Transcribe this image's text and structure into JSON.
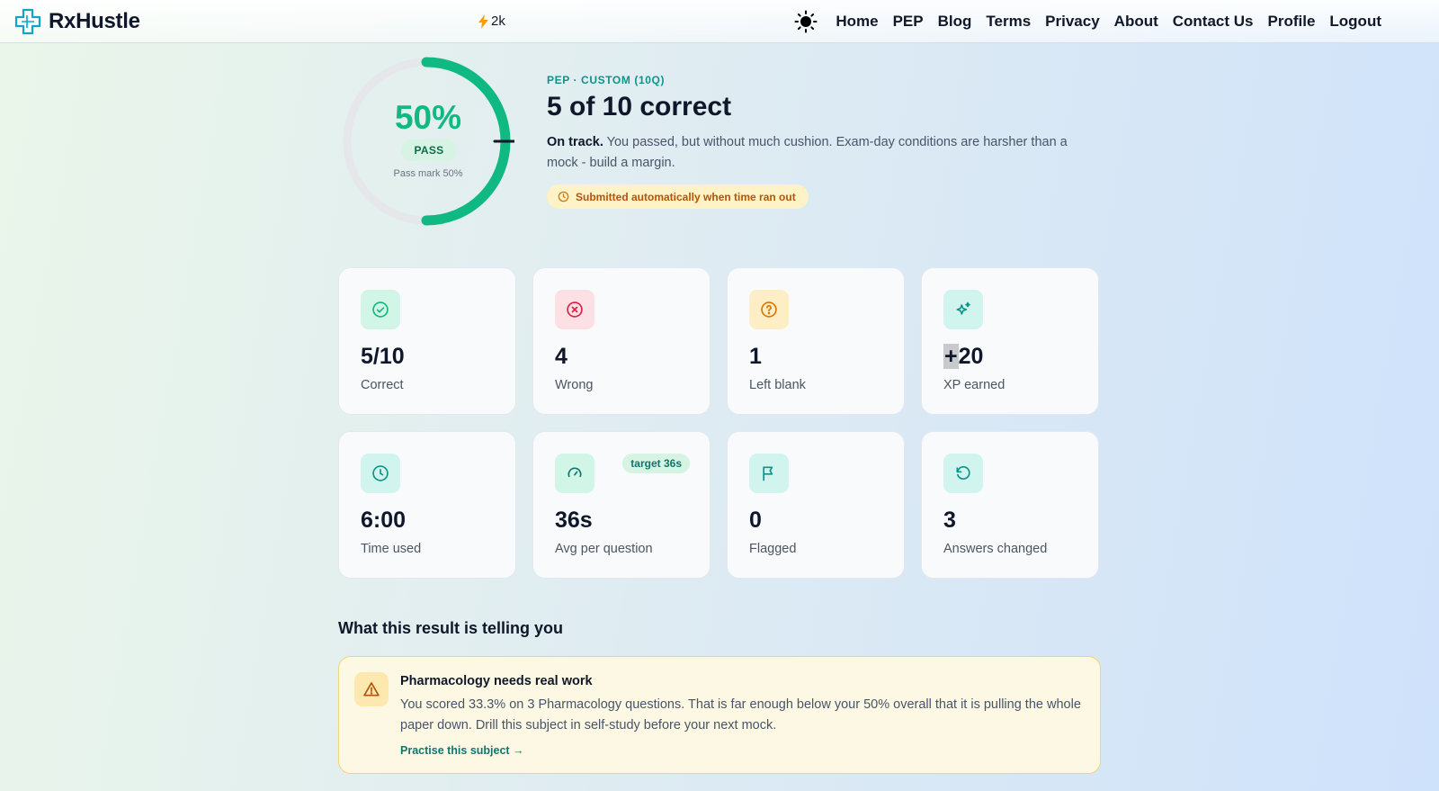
{
  "header": {
    "brand": "RxHustle",
    "streak_value": "2k",
    "nav": [
      "Home",
      "PEP",
      "Blog",
      "Terms",
      "Privacy",
      "About",
      "Contact Us",
      "Profile",
      "Logout"
    ]
  },
  "result": {
    "score_percent": "50%",
    "score_fraction": 0.5,
    "pass_mark_fraction": 0.5,
    "status_badge": "PASS",
    "pass_mark_text": "Pass mark 50%",
    "kicker": "PEP · CUSTOM (10Q)",
    "headline": "5 of 10 correct",
    "summary_lead": "On track.",
    "summary_text": " You passed, but without much cushion. Exam-day conditions are harsher than a mock - build a margin.",
    "auto_submit_note": "Submitted automatically when time ran out"
  },
  "stats": [
    {
      "value": "5/10",
      "label": "Correct",
      "icon": "check-circle-icon",
      "tint": "#d1f5e6",
      "color": "#10b981"
    },
    {
      "value": "4",
      "label": "Wrong",
      "icon": "x-circle-icon",
      "tint": "#fde0e3",
      "color": "#e11d48"
    },
    {
      "value": "1",
      "label": "Left blank",
      "icon": "question-circle-icon",
      "tint": "#fdeec5",
      "color": "#d97706"
    },
    {
      "value_prefix": "+",
      "value": "20",
      "label": "XP earned",
      "icon": "sparkles-icon",
      "tint": "#d1f5ee",
      "color": "#0d9488"
    },
    {
      "value": "6:00",
      "label": "Time used",
      "icon": "clock-icon",
      "tint": "#d1f5ee",
      "color": "#0d9488"
    },
    {
      "value": "36s",
      "label": "Avg per question",
      "icon": "gauge-icon",
      "tint": "#d1f5e6",
      "color": "#0f766e",
      "badge": "target 36s"
    },
    {
      "value": "0",
      "label": "Flagged",
      "icon": "flag-icon",
      "tint": "#d1f5ee",
      "color": "#0d9488"
    },
    {
      "value": "3",
      "label": "Answers changed",
      "icon": "undo-icon",
      "tint": "#d1f5ee",
      "color": "#0d9488"
    }
  ],
  "insights": {
    "section_title": "What this result is telling you",
    "items": [
      {
        "title": "Pharmacology needs real work",
        "body": "You scored 33.3% on 3 Pharmacology questions. That is far enough below your 50% overall that it is pulling the whole paper down. Drill this subject in self-study before your next mock.",
        "link": "Practise this subject →"
      }
    ]
  }
}
